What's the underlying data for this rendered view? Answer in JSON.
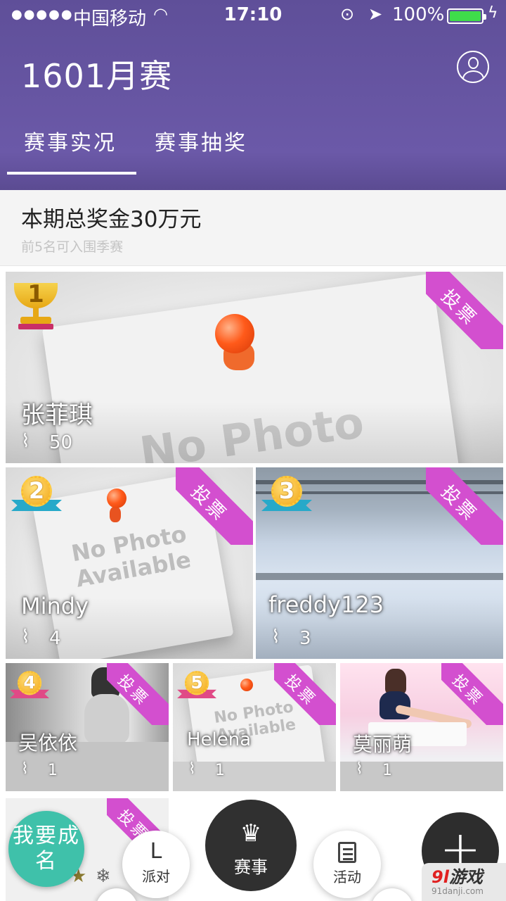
{
  "status_bar": {
    "signal": "●●●●●",
    "carrier": "中国移动",
    "time": "17:10",
    "battery": "100%"
  },
  "header": {
    "title": "1601月赛",
    "tabs": [
      {
        "label": "赛事实况",
        "active": true
      },
      {
        "label": "赛事抽奖",
        "active": false
      }
    ]
  },
  "prize": {
    "title": "本期总奖金30万元",
    "subtitle": "前5名可入围季赛"
  },
  "vote_label": "投票",
  "placeholder": {
    "line1": "No Photo",
    "line2": "Available"
  },
  "entries": [
    {
      "rank": "1",
      "name": "张菲琪",
      "likes": "50"
    },
    {
      "rank": "2",
      "name": "Mindy",
      "likes": "4"
    },
    {
      "rank": "3",
      "name": "freddy123",
      "likes": "3"
    },
    {
      "rank": "4",
      "name": "吴依依",
      "likes": "1"
    },
    {
      "rank": "5",
      "name": "Helena",
      "likes": "1"
    },
    {
      "rank": "",
      "name": "莫丽萌",
      "likes": "1"
    }
  ],
  "bottom_nav": {
    "fame": "我要成名",
    "party": "派对",
    "party_icon": "L",
    "match": "赛事",
    "activity": "活动",
    "add": "+"
  },
  "watermark": {
    "logo_num": "9l",
    "logo_text": "游戏",
    "url": "91danji.com"
  },
  "colors": {
    "header": "#6b59a8",
    "vote_band": "#d34fcf",
    "fame_button": "#3fc1aa",
    "match_button": "#303030"
  },
  "icons": {
    "user": "user-circle-icon",
    "like": "paperclip-icon",
    "match": "crown-icon",
    "activity": "document-icon",
    "add": "plus-icon"
  }
}
